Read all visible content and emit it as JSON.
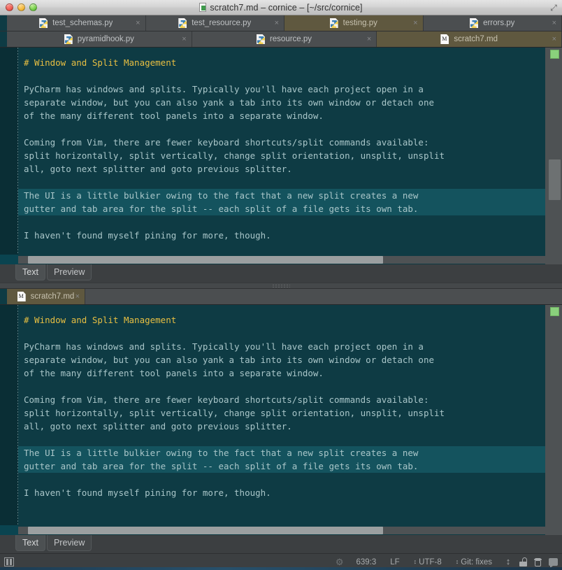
{
  "window": {
    "title": "scratch7.md – cornice – [~/src/cornice]",
    "title_icon": "markdown-document-icon",
    "traffic_lights": [
      "close-button",
      "minimize-button",
      "zoom-button"
    ],
    "expand_glyph": "⤢"
  },
  "tab_rows": [
    {
      "row": 1,
      "tabs": [
        {
          "label": "test_schemas.py",
          "icon": "python-file-icon",
          "selected": false,
          "close": "×"
        },
        {
          "label": "test_resource.py",
          "icon": "python-file-icon",
          "selected": false,
          "close": "×"
        },
        {
          "label": "testing.py",
          "icon": "python-file-icon",
          "selected": true,
          "close": "×"
        },
        {
          "label": "errors.py",
          "icon": "python-file-icon",
          "selected": false,
          "close": "×"
        }
      ]
    },
    {
      "row": 2,
      "tabs": [
        {
          "label": "pyramidhook.py",
          "icon": "python-file-icon",
          "selected": false,
          "close": "×"
        },
        {
          "label": "resource.py",
          "icon": "python-file-icon",
          "selected": false,
          "close": "×"
        },
        {
          "label": "scratch7.md",
          "icon": "markdown-file-icon",
          "selected": true,
          "close": "×"
        }
      ]
    }
  ],
  "document": {
    "lines": [
      {
        "text": "# Window and Split Management",
        "style": "heading",
        "highlighted": false
      },
      {
        "text": "",
        "style": "normal",
        "highlighted": false
      },
      {
        "text": "PyCharm has windows and splits. Typically you'll have each project open in a",
        "style": "normal",
        "highlighted": false
      },
      {
        "text": "separate window, but you can also yank a tab into its own window or detach one",
        "style": "normal",
        "highlighted": false
      },
      {
        "text": "of the many different tool panels into a separate window.",
        "style": "normal",
        "highlighted": false
      },
      {
        "text": "",
        "style": "normal",
        "highlighted": false
      },
      {
        "text": "Coming from Vim, there are fewer keyboard shortcuts/split commands available:",
        "style": "normal",
        "highlighted": false
      },
      {
        "text": "split horizontally, split vertically, change split orientation, unsplit, unsplit",
        "style": "normal",
        "highlighted": false
      },
      {
        "text": "all, goto next splitter and goto previous splitter.",
        "style": "normal",
        "highlighted": false
      },
      {
        "text": "",
        "style": "normal",
        "highlighted": false
      },
      {
        "text": "The UI is a little bulkier owing to the fact that a new split creates a new",
        "style": "normal",
        "highlighted": true
      },
      {
        "text": "gutter and tab area for the split -- each split of a file gets its own tab.",
        "style": "normal",
        "highlighted": true
      },
      {
        "text": "",
        "style": "normal",
        "highlighted": false
      },
      {
        "text": "I haven't found myself pining for more, though.",
        "style": "normal",
        "highlighted": false
      }
    ]
  },
  "lower_pane": {
    "tab": {
      "label": "scratch7.md",
      "icon": "markdown-file-icon",
      "close": "×"
    }
  },
  "view_tabs": [
    {
      "label": "Text",
      "active": true
    },
    {
      "label": "Preview",
      "active": false
    }
  ],
  "status_bar": {
    "layout_icon": "tool-window-layout-icon",
    "progress_icon": "busy-spinner-icon",
    "caret_position": "639:3",
    "line_separator": "LF",
    "encoding": "UTF-8",
    "vcs_branch": "Git: fixes",
    "caret_glyph": "⇕",
    "icons": [
      "line-separator-toggle-icon",
      "read-only-lock-icon",
      "hector-inspection-icon",
      "event-log-bubble-icon"
    ]
  },
  "colors": {
    "editor_background": "#0e3b44",
    "editor_gutter": "#0a2e35",
    "selection_highlight": "#14535e",
    "heading_text": "#e8bf42",
    "body_text": "#a9c6c9",
    "chrome": "#3c3f41",
    "tab_selected": "#5f583f",
    "rail_marker_green": "#8ad07c"
  }
}
